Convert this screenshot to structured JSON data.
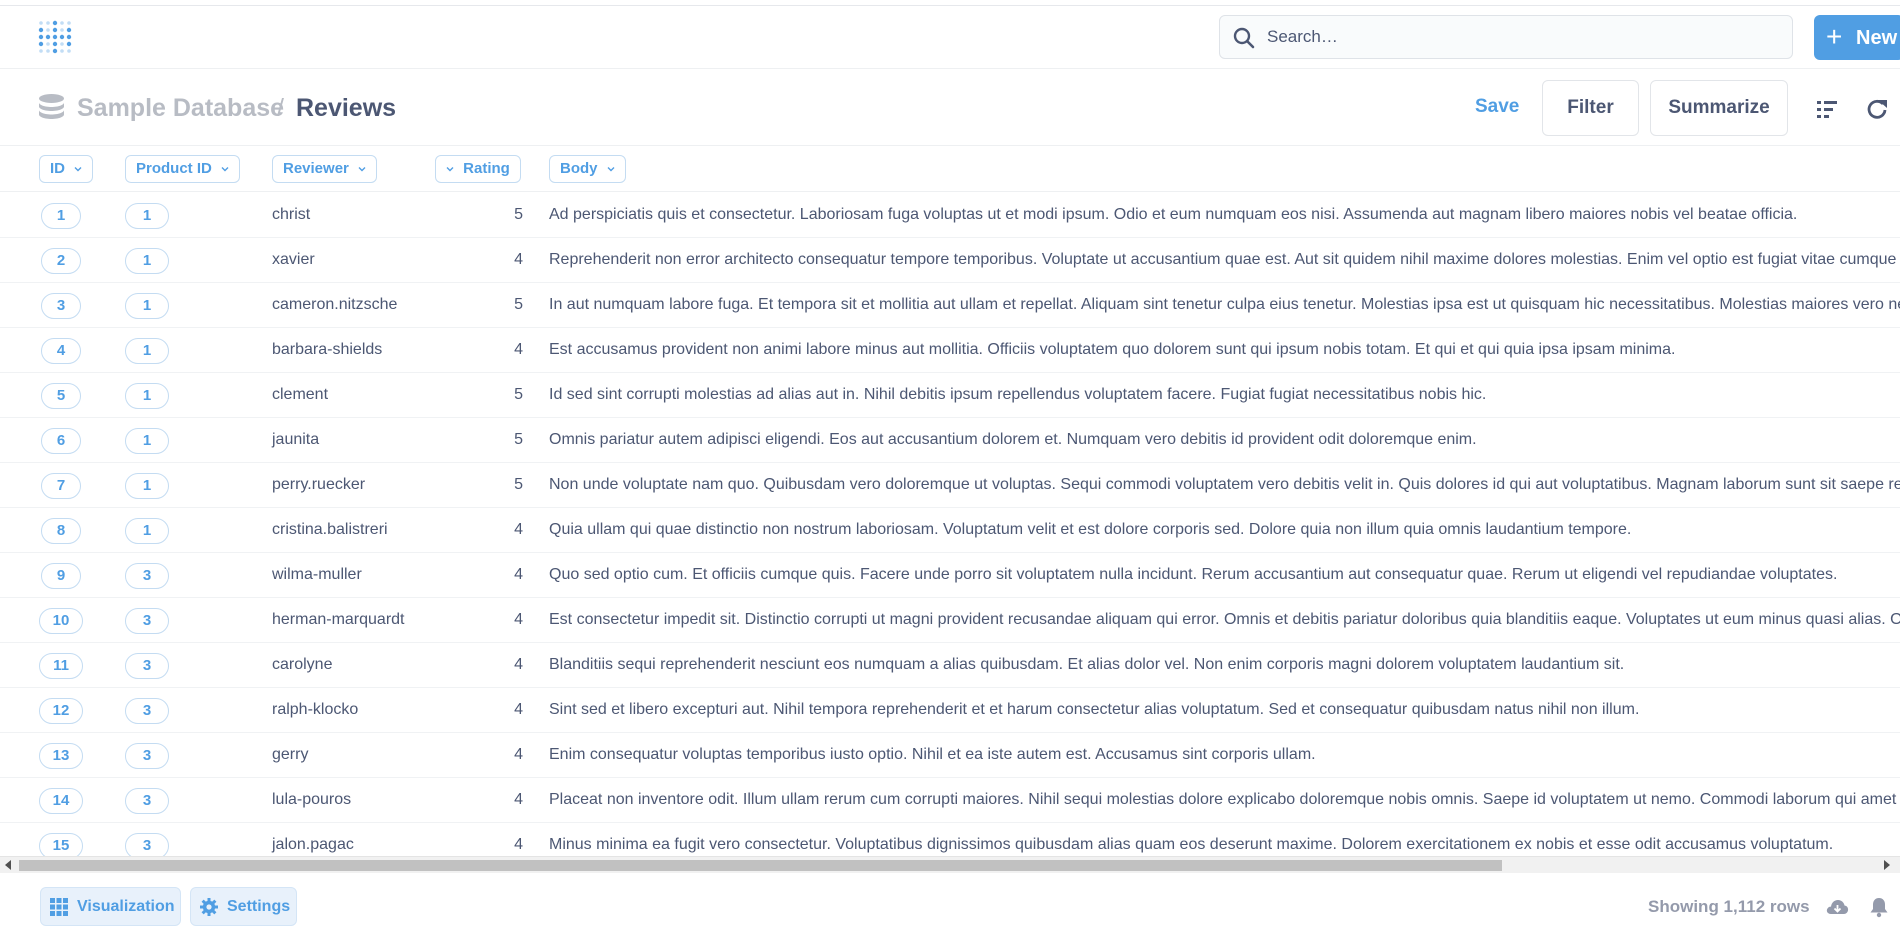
{
  "nav": {
    "search_placeholder": "Search…",
    "new_plus": "+",
    "new_label": "New"
  },
  "header": {
    "database": "Sample Database",
    "separator": "/",
    "table": "Reviews",
    "save_label": "Save",
    "filter_label": "Filter",
    "summarize_label": "Summarize"
  },
  "columns": [
    "ID",
    "Product ID",
    "Reviewer",
    "Rating",
    "Body"
  ],
  "rows": [
    {
      "id": "1",
      "product_id": "1",
      "reviewer": "christ",
      "rating": "5",
      "body": "Ad perspiciatis quis et consectetur. Laboriosam fuga voluptas ut et modi ipsum. Odio et eum numquam eos nisi. Assumenda aut magnam libero maiores nobis vel beatae officia."
    },
    {
      "id": "2",
      "product_id": "1",
      "reviewer": "xavier",
      "rating": "4",
      "body": "Reprehenderit non error architecto consequatur tempore temporibus. Voluptate ut accusantium quae est. Aut sit quidem nihil maxime dolores molestias. Enim vel optio est fugiat vitae cumque ut."
    },
    {
      "id": "3",
      "product_id": "1",
      "reviewer": "cameron.nitzsche",
      "rating": "5",
      "body": "In aut numquam labore fuga. Et tempora sit et mollitia aut ullam et repellat. Aliquam sint tenetur culpa eius tenetur. Molestias ipsa est ut quisquam hic necessitatibus. Molestias maiores vero nesciu"
    },
    {
      "id": "4",
      "product_id": "1",
      "reviewer": "barbara-shields",
      "rating": "4",
      "body": "Est accusamus provident non animi labore minus aut mollitia. Officiis voluptatem quo dolorem sunt qui ipsum nobis totam. Et qui et qui quia ipsa ipsam minima."
    },
    {
      "id": "5",
      "product_id": "1",
      "reviewer": "clement",
      "rating": "5",
      "body": "Id sed sint corrupti molestias ad alias aut in. Nihil debitis ipsum repellendus voluptatem facere. Fugiat fugiat necessitatibus nobis hic."
    },
    {
      "id": "6",
      "product_id": "1",
      "reviewer": "jaunita",
      "rating": "5",
      "body": "Omnis pariatur autem adipisci eligendi. Eos aut accusantium dolorem et. Numquam vero debitis id provident odit doloremque enim."
    },
    {
      "id": "7",
      "product_id": "1",
      "reviewer": "perry.ruecker",
      "rating": "5",
      "body": "Non unde voluptate nam quo. Quibusdam vero doloremque ut voluptas. Sequi commodi voluptatem vero debitis velit in. Quis dolores id qui aut voluptatibus. Magnam laborum sunt sit saepe repreh"
    },
    {
      "id": "8",
      "product_id": "1",
      "reviewer": "cristina.balistreri",
      "rating": "4",
      "body": "Quia ullam qui quae distinctio non nostrum laboriosam. Voluptatum velit et est dolore corporis sed. Dolore quia non illum quia omnis laudantium tempore."
    },
    {
      "id": "9",
      "product_id": "3",
      "reviewer": "wilma-muller",
      "rating": "4",
      "body": "Quo sed optio cum. Et officiis cumque quis. Facere unde porro sit voluptatem nulla incidunt. Rerum accusantium aut consequatur quae. Rerum ut eligendi vel repudiandae voluptates."
    },
    {
      "id": "10",
      "product_id": "3",
      "reviewer": "herman-marquardt",
      "rating": "4",
      "body": "Est consectetur impedit sit. Distinctio corrupti ut magni provident recusandae aliquam qui error. Omnis et debitis pariatur doloribus quia blanditiis eaque. Voluptates ut eum minus quasi alias. Offic"
    },
    {
      "id": "11",
      "product_id": "3",
      "reviewer": "carolyne",
      "rating": "4",
      "body": "Blanditiis sequi reprehenderit nesciunt eos numquam a alias quibusdam. Et alias dolor vel. Non enim corporis magni dolorem voluptatem laudantium sit."
    },
    {
      "id": "12",
      "product_id": "3",
      "reviewer": "ralph-klocko",
      "rating": "4",
      "body": "Sint sed et libero excepturi aut. Nihil tempora reprehenderit et et harum consectetur alias voluptatum. Sed et consequatur quibusdam natus nihil non illum."
    },
    {
      "id": "13",
      "product_id": "3",
      "reviewer": "gerry",
      "rating": "4",
      "body": "Enim consequatur voluptas temporibus iusto optio. Nihil et ea iste autem est. Accusamus sint corporis ullam."
    },
    {
      "id": "14",
      "product_id": "3",
      "reviewer": "lula-pouros",
      "rating": "4",
      "body": "Placeat non inventore odit. Illum ullam rerum cum corrupti maiores. Nihil sequi molestias dolore explicabo doloremque nobis omnis. Saepe id voluptatem ut nemo. Commodi laborum qui amet hic re"
    },
    {
      "id": "15",
      "product_id": "3",
      "reviewer": "jalon.pagac",
      "rating": "4",
      "body": "Minus minima ea fugit vero consectetur. Voluptatibus dignissimos quibusdam alias quam eos deserunt maxime. Dolorem exercitationem ex nobis et esse odit accusamus voluptatum."
    }
  ],
  "footer": {
    "visualization_label": "Visualization",
    "settings_label": "Settings",
    "row_count": "Showing 1,112 rows"
  },
  "icons": {
    "logo": "metabase-logo-icon",
    "search": "search-icon",
    "database": "database-icon",
    "notebook": "notebook-icon",
    "refresh": "refresh-icon",
    "grid": "table-grid-icon",
    "gear": "gear-icon",
    "download": "download-icon",
    "bell": "bell-icon"
  },
  "colors": {
    "brand": "#509ee3",
    "text": "#4c5773",
    "muted": "#949aab"
  }
}
